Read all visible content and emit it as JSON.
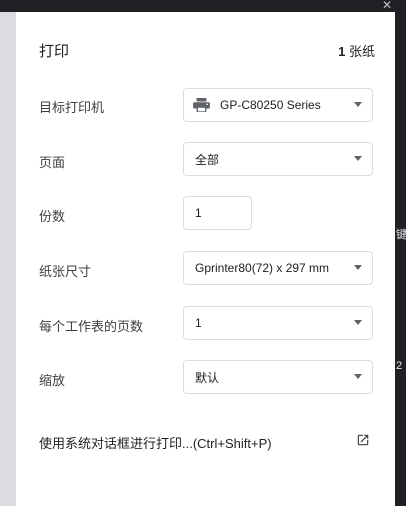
{
  "header": {
    "title": "打印",
    "sheet_count_number": "1",
    "sheet_count_unit": "张纸"
  },
  "fields": {
    "destination": {
      "label": "目标打印机",
      "value": "GP-C80250 Series",
      "icon": "printer-icon"
    },
    "pages": {
      "label": "页面",
      "value": "全部"
    },
    "copies": {
      "label": "份数",
      "value": "1"
    },
    "paper_size": {
      "label": "纸张尺寸",
      "value": "Gprinter80(72) x 297 mm"
    },
    "pages_per_sheet": {
      "label": "每个工作表的页数",
      "value": "1"
    },
    "scale": {
      "label": "缩放",
      "value": "默认"
    }
  },
  "system_dialog": {
    "label": "使用系统对话框进行打印...(Ctrl+Shift+P)",
    "icon": "open-external-icon"
  },
  "edge_glyphs": {
    "right_1": "键",
    "right_2": "2"
  },
  "colors": {
    "panel_bg": "#ffffff",
    "border": "#dadce0",
    "text": "#202124",
    "dark_bg": "#202124",
    "preview_bg": "#dadce0"
  }
}
